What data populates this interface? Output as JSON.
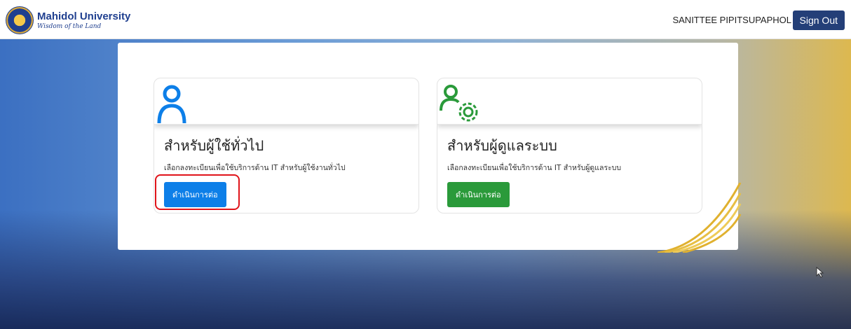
{
  "header": {
    "logo_name": "Mahidol University",
    "logo_tagline": "Wisdom of the Land",
    "user_name": "SANITTEE PIPITSUPAPHOL",
    "signout_label": "Sign Out"
  },
  "cards": [
    {
      "icon": "user-icon",
      "title": "สำหรับผู้ใช้ทั่วไป",
      "description": "เลือกลงทะเบียนเพื่อใช้บริการด้าน IT สำหรับผู้ใช้งานทั่วไป",
      "button_label": "ดำเนินการต่อ",
      "accent": "#0d7fe8"
    },
    {
      "icon": "admin-user-gear-icon",
      "title": "สำหรับผู้ดูแลระบบ",
      "description": "เลือกลงทะเบียนเพื่อใช้บริการด้าน IT สำหรับผู้ดูแลระบบ",
      "button_label": "ดำเนินการต่อ",
      "accent": "#2a9a3a"
    }
  ],
  "colors": {
    "header_bg": "#ffffff",
    "signout_bg": "#243f78",
    "highlight": "#e0141a"
  }
}
